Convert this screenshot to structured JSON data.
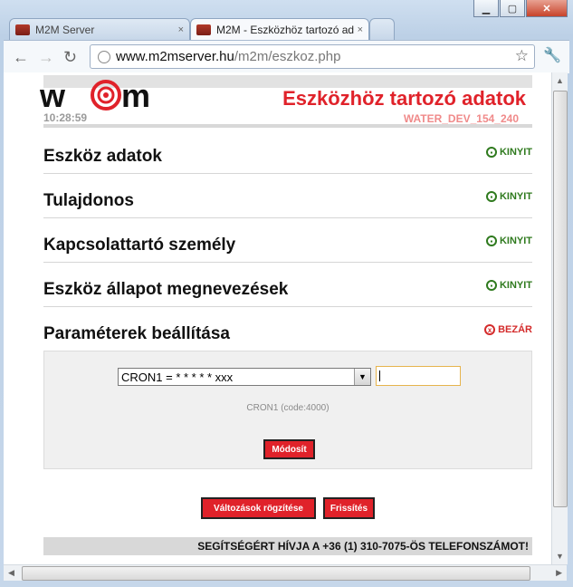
{
  "tabs": [
    {
      "label": "M2M Server",
      "close": "×"
    },
    {
      "label": "M2M - Eszközhöz tartozó ad",
      "close": "×"
    }
  ],
  "url": {
    "host": "www.m2mserver.hu",
    "path": "/m2m/eszkoz.php"
  },
  "header": {
    "title": "Eszközhöz tartozó adatok",
    "time": "10:28:59",
    "device_id": "WATER_DEV_154_240"
  },
  "sections": [
    {
      "title": "Eszköz adatok",
      "action": "KINYIT"
    },
    {
      "title": "Tulajdonos",
      "action": "KINYIT"
    },
    {
      "title": "Kapcsolattartó személy",
      "action": "KINYIT"
    },
    {
      "title": "Eszköz állapot megnevezések",
      "action": "KINYIT"
    },
    {
      "title": "Paraméterek beállítása",
      "action": "BEZÁR"
    }
  ],
  "params": {
    "select_value": "CRON1 = * * * * * xxx",
    "input_value": "",
    "hint": "CRON1 (code:4000)",
    "modify_label": "Módosít"
  },
  "buttons": {
    "save_changes": "Változások rögzítése",
    "refresh": "Frissítés"
  },
  "footer": {
    "text": "SEGÍTSÉGÉRT HÍVJA A +36 (1) 310-7075-ÖS TELEFONSZÁMOT!"
  },
  "colors": {
    "accent_red": "#e0222a",
    "open_green": "#2f7a1e",
    "device_pink": "#f08a8a"
  },
  "icons": {
    "open": "open-square-icon",
    "close": "close-x-icon",
    "star": "star-icon",
    "wrench": "wrench-icon"
  }
}
